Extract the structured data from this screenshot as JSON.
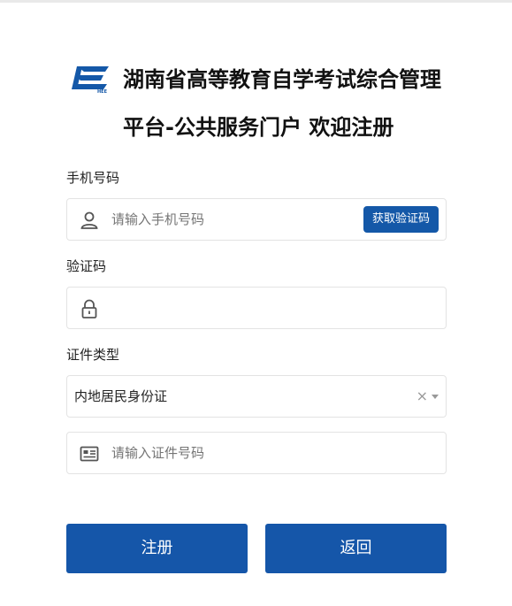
{
  "header": {
    "title_line1": "湖南省高等教育自学考试综合管理",
    "title_line2": "平台-公共服务门户 欢迎注册",
    "logo_icon": "hnee-logo",
    "accent_color": "#1458a8"
  },
  "form": {
    "phone": {
      "label": "手机号码",
      "placeholder": "请输入手机号码",
      "icon": "user-icon",
      "get_code_button": "获取验证码"
    },
    "code": {
      "label": "验证码",
      "placeholder": "",
      "icon": "lock-icon"
    },
    "id_type": {
      "label": "证件类型",
      "selected": "内地居民身份证",
      "clear_symbol": "×"
    },
    "id_number": {
      "placeholder": "请输入证件号码",
      "icon": "id-card-icon"
    }
  },
  "actions": {
    "register_label": "注册",
    "back_label": "返回"
  }
}
